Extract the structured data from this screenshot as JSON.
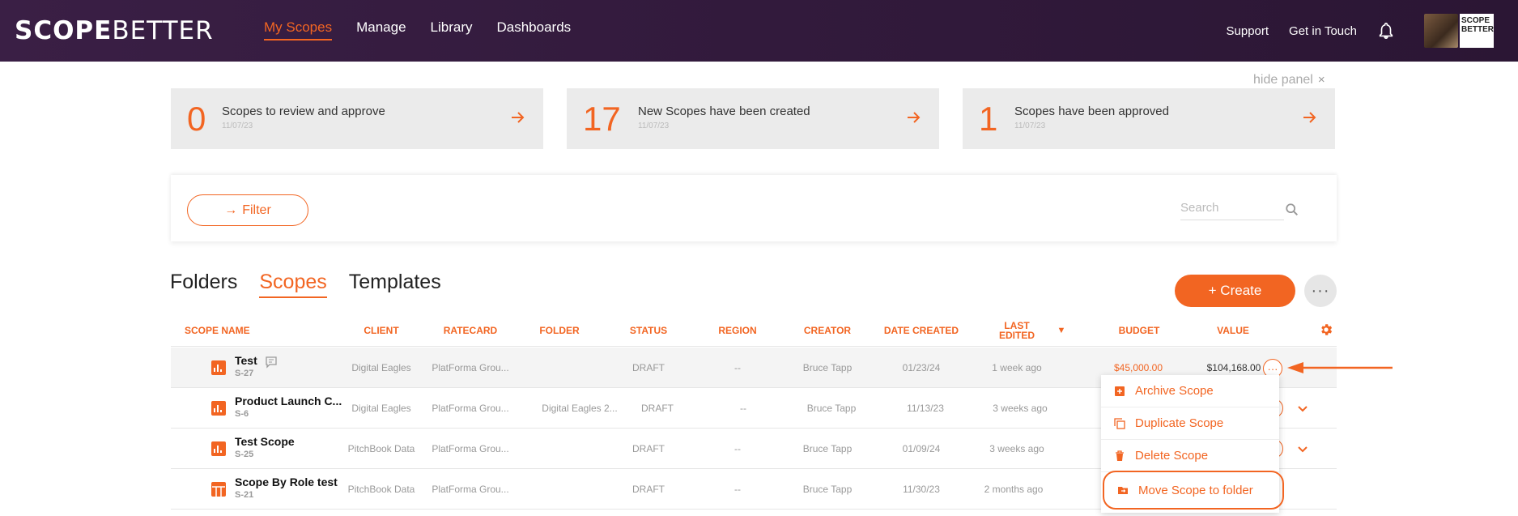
{
  "header": {
    "logo_bold": "SCOPE",
    "logo_light": "BETTER",
    "nav": [
      "My Scopes",
      "Manage",
      "Library",
      "Dashboards"
    ],
    "support": "Support",
    "get_in_touch": "Get in Touch",
    "mini_logo": "SCOPE BETTER"
  },
  "panel": {
    "hide_label": "hide panel",
    "close": "×",
    "cards": [
      {
        "num": "0",
        "text": "Scopes to review and approve",
        "date": "11/07/23"
      },
      {
        "num": "17",
        "text": "New Scopes have been created",
        "date": "11/07/23"
      },
      {
        "num": "1",
        "text": "Scopes have been approved",
        "date": "11/07/23"
      }
    ]
  },
  "filter": {
    "label": "Filter",
    "arrow": "→",
    "search_placeholder": "Search"
  },
  "tabs": [
    "Folders",
    "Scopes",
    "Templates"
  ],
  "create_label": "+ Create",
  "more_label": "···",
  "columns": [
    "Scope Name",
    "Client",
    "Ratecard",
    "Folder",
    "Status",
    "Region",
    "Creator",
    "Date Created",
    "Last Edited",
    "Budget",
    "Value"
  ],
  "sort_indicator": "▼",
  "rows": [
    {
      "name": "Test",
      "id": "S-27",
      "client": "Digital Eagles",
      "ratecard": "PlatForma Grou...",
      "folder": "",
      "status": "DRAFT",
      "region": "--",
      "creator": "Bruce Tapp",
      "created": "01/23/24",
      "edited": "1 week ago",
      "budget": "$45,000.00",
      "value": "$104,168.00"
    },
    {
      "name": "Product Launch C...",
      "id": "S-6",
      "client": "Digital Eagles",
      "ratecard": "PlatForma Grou...",
      "folder": "Digital Eagles 2...",
      "status": "DRAFT",
      "region": "--",
      "creator": "Bruce Tapp",
      "created": "11/13/23",
      "edited": "3 weeks ago",
      "budget": "",
      "value": ""
    },
    {
      "name": "Test Scope",
      "id": "S-25",
      "client": "PitchBook Data",
      "ratecard": "PlatForma Grou...",
      "folder": "",
      "status": "DRAFT",
      "region": "--",
      "creator": "Bruce Tapp",
      "created": "01/09/24",
      "edited": "3 weeks ago",
      "budget": "",
      "value": ""
    },
    {
      "name": "Scope By Role test",
      "id": "S-21",
      "client": "PitchBook Data",
      "ratecard": "PlatForma Grou...",
      "folder": "",
      "status": "DRAFT",
      "region": "--",
      "creator": "Bruce Tapp",
      "created": "11/30/23",
      "edited": "2 months ago",
      "budget": "",
      "value": ""
    }
  ],
  "row_menu": {
    "dots": "···",
    "items": [
      "Archive Scope",
      "Duplicate Scope",
      "Delete Scope",
      "Move Scope to folder"
    ]
  },
  "colors": {
    "accent": "#f26522",
    "header_bg": "#321a3c",
    "card_bg": "#ebebeb"
  }
}
